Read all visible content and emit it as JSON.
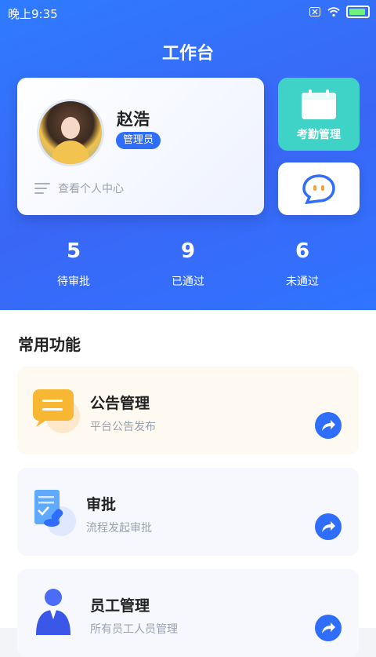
{
  "status_bar": {
    "time": "晚上9:35"
  },
  "header": {
    "title": "工作台"
  },
  "profile": {
    "name": "赵浩",
    "role": "管理员",
    "center_link": "查看个人中心"
  },
  "quick": {
    "attendance_label": "考勤管理"
  },
  "stats": [
    {
      "value": "5",
      "label": "待审批"
    },
    {
      "value": "9",
      "label": "已通过"
    },
    {
      "value": "6",
      "label": "未通过"
    }
  ],
  "functions": {
    "title": "常用功能",
    "items": [
      {
        "title": "公告管理",
        "subtitle": "平台公告发布"
      },
      {
        "title": "审批",
        "subtitle": "流程发起审批"
      },
      {
        "title": "员工管理",
        "subtitle": "所有员工人员管理"
      }
    ]
  },
  "colors": {
    "primary": "#2f6dfc",
    "teal": "#3ed3c6",
    "amber": "#f7b733"
  }
}
